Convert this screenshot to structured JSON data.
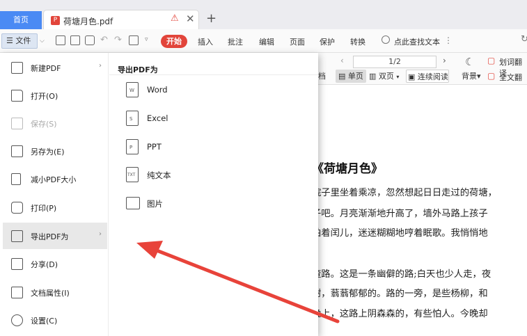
{
  "tabs": {
    "home_label": "首页",
    "doc_title": "荷塘月色.pdf"
  },
  "toolbar": {
    "file_label": "文件",
    "start_label": "开始",
    "menu_tabs": [
      "插入",
      "批注",
      "编辑",
      "页面",
      "保护",
      "转换"
    ],
    "search_placeholder": "点此查找文本"
  },
  "ribbon": {
    "page_indicator": "1/2",
    "single_page": "单页",
    "double_page": "双页",
    "continuous": "连续阅读",
    "background": "背景",
    "word_translate": "划词翻译",
    "full_translate": "全文翻译",
    "partial_doc": "档"
  },
  "file_menu": {
    "items": [
      {
        "label": "新建PDF",
        "icon": "new-pdf-icon",
        "has_submenu": true,
        "disabled": false,
        "active": false
      },
      {
        "label": "打开(O)",
        "icon": "folder-open-icon",
        "has_submenu": false,
        "disabled": false,
        "active": false
      },
      {
        "label": "保存(S)",
        "icon": "save-icon",
        "has_submenu": false,
        "disabled": true,
        "active": false
      },
      {
        "label": "另存为(E)",
        "icon": "save-as-icon",
        "has_submenu": false,
        "disabled": false,
        "active": false
      },
      {
        "label": "减小PDF大小",
        "icon": "compress-icon",
        "has_submenu": false,
        "disabled": false,
        "active": false
      },
      {
        "label": "打印(P)",
        "icon": "printer-icon",
        "has_submenu": false,
        "disabled": false,
        "active": false
      },
      {
        "label": "导出PDF为",
        "icon": "export-icon",
        "has_submenu": true,
        "disabled": false,
        "active": true
      },
      {
        "label": "分享(D)",
        "icon": "share-icon",
        "has_submenu": false,
        "disabled": false,
        "active": false
      },
      {
        "label": "文档属性(I)",
        "icon": "properties-icon",
        "has_submenu": false,
        "disabled": false,
        "active": false
      },
      {
        "label": "设置(C)",
        "icon": "settings-icon",
        "has_submenu": false,
        "disabled": false,
        "active": false
      }
    ]
  },
  "export_submenu": {
    "header": "导出PDF为",
    "options": [
      {
        "label": "Word",
        "icon": "word-file-icon",
        "tag": "W"
      },
      {
        "label": "Excel",
        "icon": "excel-file-icon",
        "tag": "S"
      },
      {
        "label": "PPT",
        "icon": "ppt-file-icon",
        "tag": "P"
      },
      {
        "label": "纯文本",
        "icon": "text-file-icon",
        "tag": "TXT"
      },
      {
        "label": "图片",
        "icon": "image-file-icon",
        "tag": ""
      }
    ]
  },
  "document": {
    "title": "《荷塘月色》",
    "lines": [
      "院子里坐着乘凉，忽然想起日日走过的荷塘，",
      "子吧。月亮渐渐地升高了，墙外马路上孩子",
      "拍着闰儿，迷迷糊糊地哼着眠歌。我悄悄地",
      "",
      "渣路。这是一条幽僻的路;白天也少人走，夜",
      "树，蓊蓊郁郁的。路的一旁，是些杨柳，和",
      "晚上，这路上阴森森的，有些怕人。今晚却"
    ]
  },
  "annotation_color": "#e8433a",
  "accent_color": "#4a8af4"
}
